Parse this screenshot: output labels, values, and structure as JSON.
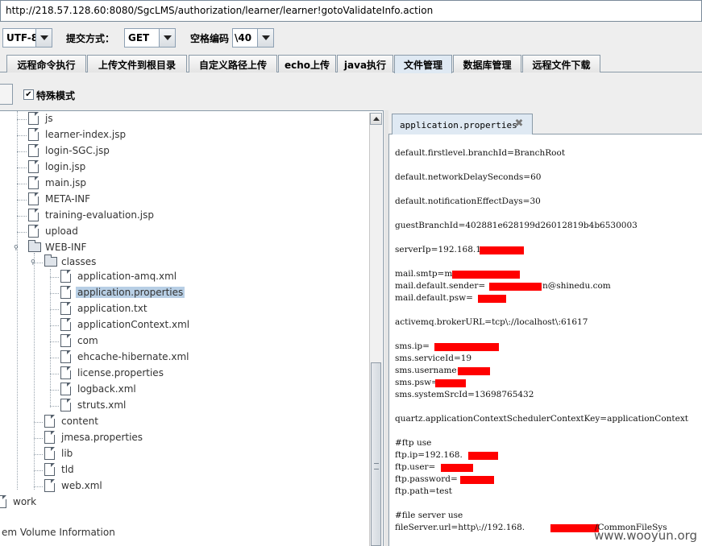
{
  "url_bar": {
    "value": "http://218.57.128.60:8080/SgcLMS/authorization/learner/learner!gotoValidateInfo.action"
  },
  "options": {
    "encoding_value": "UTF-8",
    "submit_label": "提交方式：",
    "method_value": "GET",
    "space_label": "空格编码",
    "space_value": "\\40"
  },
  "tabs": [
    {
      "label": "远程命令执行",
      "active": false
    },
    {
      "label": "上传文件到根目录",
      "active": false
    },
    {
      "label": "自定义路径上传",
      "active": false
    },
    {
      "label": "echo上传",
      "active": false
    },
    {
      "label": "java执行",
      "active": false
    },
    {
      "label": "文件管理",
      "active": true
    },
    {
      "label": "数据库管理",
      "active": false
    },
    {
      "label": "远程文件下载",
      "active": false
    }
  ],
  "toolbar": {
    "special_mode_label": "特殊模式",
    "special_mode_checked": true,
    "checkmark": "✔"
  },
  "tree": {
    "nodes": [
      {
        "label": "js",
        "type": "file"
      },
      {
        "label": "learner-index.jsp",
        "type": "file"
      },
      {
        "label": "login-SGC.jsp",
        "type": "file"
      },
      {
        "label": "login.jsp",
        "type": "file"
      },
      {
        "label": "main.jsp",
        "type": "file"
      },
      {
        "label": "META-INF",
        "type": "file"
      },
      {
        "label": "training-evaluation.jsp",
        "type": "file"
      },
      {
        "label": "upload",
        "type": "file"
      },
      {
        "label": "WEB-INF",
        "type": "folder",
        "expanded": true
      },
      {
        "label": "classes",
        "type": "folder",
        "expanded": true
      },
      {
        "label": "application-amq.xml",
        "type": "file"
      },
      {
        "label": "application.properties",
        "type": "file",
        "selected": true
      },
      {
        "label": "application.txt",
        "type": "file"
      },
      {
        "label": "applicationContext.xml",
        "type": "file"
      },
      {
        "label": "com",
        "type": "file"
      },
      {
        "label": "ehcache-hibernate.xml",
        "type": "file"
      },
      {
        "label": "license.properties",
        "type": "file"
      },
      {
        "label": "logback.xml",
        "type": "file"
      },
      {
        "label": "struts.xml",
        "type": "file"
      },
      {
        "label": "content",
        "type": "file"
      },
      {
        "label": "jmesa.properties",
        "type": "file"
      },
      {
        "label": "lib",
        "type": "file"
      },
      {
        "label": "tld",
        "type": "file"
      },
      {
        "label": "web.xml",
        "type": "file"
      },
      {
        "label": "work",
        "type": "file"
      },
      {
        "label": "em Volume Information",
        "type": "text"
      }
    ],
    "toggle_glyph": "⚲"
  },
  "editor": {
    "tab_label": "application.properties",
    "close_glyph": "✖",
    "lines": [
      "default.firstlevel.branchId=BranchRoot",
      "default.networkDelaySeconds=60",
      "default.notificationEffectDays=30",
      "guestBranchId=402881e628199d26012819b4b6530003",
      "serverIp=192.168.1",
      "mail.smtp=m",
      "mail.default.sender=",
      "n@shinedu.com",
      "mail.default.psw=",
      "activemq.brokerURL=tcp\\://localhost\\:61617",
      "sms.ip=",
      "sms.serviceId=19",
      "sms.username=",
      "sms.psw=",
      "sms.systemSrcId=13698765432",
      "quartz.applicationContextSchedulerContextKey=applicationContext",
      "#ftp use",
      "ftp.ip=192.168.",
      "ftp.user=",
      "ftp.password=",
      "ftp.path=test",
      "#file server use",
      "fileServer.url=http\\://192.168.",
      "/CommonFileSys"
    ]
  },
  "watermark": "www.wooyun.org",
  "colors": {
    "redaction": "#ff0000",
    "selection": "#b8cfe5",
    "active_tab": "#dfe9f3"
  }
}
